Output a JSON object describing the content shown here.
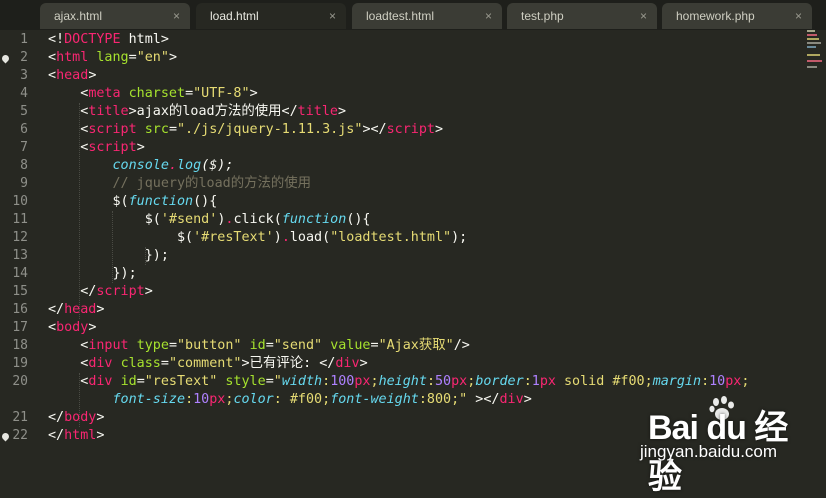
{
  "tabs": [
    {
      "label": "ajax.html",
      "close": "×"
    },
    {
      "label": "load.html",
      "close": "×"
    },
    {
      "label": "loadtest.html",
      "close": "×"
    },
    {
      "label": "test.php",
      "close": "×"
    },
    {
      "label": "homework.php",
      "close": "×"
    }
  ],
  "active_tab": "load.html",
  "line_numbers": [
    "1",
    "2",
    "3",
    "4",
    "5",
    "6",
    "7",
    "8",
    "9",
    "10",
    "11",
    "12",
    "13",
    "14",
    "15",
    "16",
    "17",
    "18",
    "19",
    "20",
    "",
    "21",
    "22"
  ],
  "colors": {
    "background": "#272822",
    "tag": "#f92672",
    "attr": "#a6e22e",
    "string": "#e6db74",
    "function": "#66d9ef",
    "comment": "#75715e",
    "number": "#ae81ff",
    "text": "#f8f8f2"
  },
  "code": {
    "l1": [
      {
        "t": "<!",
        "c": "text"
      },
      {
        "t": "DOCTYPE",
        "c": "tag"
      },
      {
        "t": " html>",
        "c": "text"
      }
    ],
    "l2": [
      {
        "t": "<",
        "c": "text"
      },
      {
        "t": "html",
        "c": "tag"
      },
      {
        "t": " ",
        "c": "text"
      },
      {
        "t": "lang",
        "c": "attr"
      },
      {
        "t": "=",
        "c": "text"
      },
      {
        "t": "\"en\"",
        "c": "string"
      },
      {
        "t": ">",
        "c": "text"
      }
    ],
    "l3": [
      {
        "t": "<",
        "c": "text"
      },
      {
        "t": "head",
        "c": "tag"
      },
      {
        "t": ">",
        "c": "text"
      }
    ],
    "l4": [
      {
        "t": "    <",
        "c": "text"
      },
      {
        "t": "meta",
        "c": "tag"
      },
      {
        "t": " ",
        "c": "text"
      },
      {
        "t": "charset",
        "c": "attr"
      },
      {
        "t": "=",
        "c": "text"
      },
      {
        "t": "\"UTF-8\"",
        "c": "string"
      },
      {
        "t": ">",
        "c": "text"
      }
    ],
    "l5": [
      {
        "t": "    <",
        "c": "text"
      },
      {
        "t": "title",
        "c": "tag"
      },
      {
        "t": ">ajax的load方法的使用</",
        "c": "text"
      },
      {
        "t": "title",
        "c": "tag"
      },
      {
        "t": ">",
        "c": "text"
      }
    ],
    "l6": [
      {
        "t": "    <",
        "c": "text"
      },
      {
        "t": "script",
        "c": "tag"
      },
      {
        "t": " ",
        "c": "text"
      },
      {
        "t": "src",
        "c": "attr"
      },
      {
        "t": "=",
        "c": "text"
      },
      {
        "t": "\"./js/jquery-1.11.3.js\"",
        "c": "string"
      },
      {
        "t": "></",
        "c": "text"
      },
      {
        "t": "script",
        "c": "tag"
      },
      {
        "t": ">",
        "c": "text"
      }
    ],
    "l7": [
      {
        "t": "    <",
        "c": "text"
      },
      {
        "t": "script",
        "c": "tag"
      },
      {
        "t": ">",
        "c": "text"
      }
    ],
    "l8": [
      {
        "t": "        ",
        "c": "text"
      },
      {
        "t": "console",
        "c": "function"
      },
      {
        "t": ".",
        "c": "tag"
      },
      {
        "t": "log",
        "c": "function"
      },
      {
        "t": "($);",
        "c": "text"
      }
    ],
    "l9": [
      {
        "t": "        // jquery的load的方法的使用",
        "c": "comment"
      }
    ],
    "l10": [
      {
        "t": "        $(",
        "c": "text"
      },
      {
        "t": "function",
        "c": "function"
      },
      {
        "t": "(){",
        "c": "text"
      }
    ],
    "l11": [
      {
        "t": "            $(",
        "c": "text"
      },
      {
        "t": "'#send'",
        "c": "string"
      },
      {
        "t": ")",
        "c": "text"
      },
      {
        "t": ".",
        "c": "tag"
      },
      {
        "t": "click(",
        "c": "text"
      },
      {
        "t": "function",
        "c": "function"
      },
      {
        "t": "(){",
        "c": "text"
      }
    ],
    "l12": [
      {
        "t": "                $(",
        "c": "text"
      },
      {
        "t": "'#resText'",
        "c": "string"
      },
      {
        "t": ")",
        "c": "text"
      },
      {
        "t": ".",
        "c": "tag"
      },
      {
        "t": "load(",
        "c": "text"
      },
      {
        "t": "\"loadtest.html\"",
        "c": "string"
      },
      {
        "t": ");",
        "c": "text"
      }
    ],
    "l13": [
      {
        "t": "            });",
        "c": "text"
      }
    ],
    "l14": [
      {
        "t": "        });",
        "c": "text"
      }
    ],
    "l15": [
      {
        "t": "    </",
        "c": "text"
      },
      {
        "t": "script",
        "c": "tag"
      },
      {
        "t": ">",
        "c": "text"
      }
    ],
    "l16": [
      {
        "t": "</",
        "c": "text"
      },
      {
        "t": "head",
        "c": "tag"
      },
      {
        "t": ">",
        "c": "text"
      }
    ],
    "l17": [
      {
        "t": "<",
        "c": "text"
      },
      {
        "t": "body",
        "c": "tag"
      },
      {
        "t": ">",
        "c": "text"
      }
    ],
    "l18": [
      {
        "t": "    <",
        "c": "text"
      },
      {
        "t": "input",
        "c": "tag"
      },
      {
        "t": " ",
        "c": "text"
      },
      {
        "t": "type",
        "c": "attr"
      },
      {
        "t": "=",
        "c": "text"
      },
      {
        "t": "\"button\"",
        "c": "string"
      },
      {
        "t": " ",
        "c": "text"
      },
      {
        "t": "id",
        "c": "attr"
      },
      {
        "t": "=",
        "c": "text"
      },
      {
        "t": "\"send\"",
        "c": "string"
      },
      {
        "t": " ",
        "c": "text"
      },
      {
        "t": "value",
        "c": "attr"
      },
      {
        "t": "=",
        "c": "text"
      },
      {
        "t": "\"Ajax获取\"",
        "c": "string"
      },
      {
        "t": "/>",
        "c": "text"
      }
    ],
    "l19": [
      {
        "t": "    <",
        "c": "text"
      },
      {
        "t": "div",
        "c": "tag"
      },
      {
        "t": " ",
        "c": "text"
      },
      {
        "t": "class",
        "c": "attr"
      },
      {
        "t": "=",
        "c": "text"
      },
      {
        "t": "\"comment\"",
        "c": "string"
      },
      {
        "t": ">已有评论: </",
        "c": "text"
      },
      {
        "t": "div",
        "c": "tag"
      },
      {
        "t": ">",
        "c": "text"
      }
    ],
    "l20": [
      {
        "t": "    <",
        "c": "text"
      },
      {
        "t": "div",
        "c": "tag"
      },
      {
        "t": " ",
        "c": "text"
      },
      {
        "t": "id",
        "c": "attr"
      },
      {
        "t": "=",
        "c": "text"
      },
      {
        "t": "\"resText\"",
        "c": "string"
      },
      {
        "t": " ",
        "c": "text"
      },
      {
        "t": "style",
        "c": "attr"
      },
      {
        "t": "=",
        "c": "text"
      },
      {
        "t": "\"",
        "c": "string"
      },
      {
        "t": "width",
        "c": "function"
      },
      {
        "t": ":",
        "c": "string"
      },
      {
        "t": "100",
        "c": "number"
      },
      {
        "t": "px",
        "c": "tag"
      },
      {
        "t": ";",
        "c": "string"
      },
      {
        "t": "height",
        "c": "function"
      },
      {
        "t": ":",
        "c": "string"
      },
      {
        "t": "50",
        "c": "number"
      },
      {
        "t": "px",
        "c": "tag"
      },
      {
        "t": ";",
        "c": "string"
      },
      {
        "t": "border",
        "c": "function"
      },
      {
        "t": ":",
        "c": "string"
      },
      {
        "t": "1",
        "c": "number"
      },
      {
        "t": "px",
        "c": "tag"
      },
      {
        "t": " solid #f00;",
        "c": "string"
      },
      {
        "t": "margin",
        "c": "function"
      },
      {
        "t": ":",
        "c": "string"
      },
      {
        "t": "10",
        "c": "number"
      },
      {
        "t": "px",
        "c": "tag"
      },
      {
        "t": ";",
        "c": "string"
      }
    ],
    "l20b": [
      {
        "t": "        ",
        "c": "text"
      },
      {
        "t": "font-size",
        "c": "function"
      },
      {
        "t": ":",
        "c": "string"
      },
      {
        "t": "10",
        "c": "number"
      },
      {
        "t": "px",
        "c": "tag"
      },
      {
        "t": ";",
        "c": "string"
      },
      {
        "t": "color",
        "c": "function"
      },
      {
        "t": ": #f00;",
        "c": "string"
      },
      {
        "t": "font-weight",
        "c": "function"
      },
      {
        "t": ":800;\"",
        "c": "string"
      },
      {
        "t": " ></",
        "c": "text"
      },
      {
        "t": "div",
        "c": "tag"
      },
      {
        "t": ">",
        "c": "text"
      }
    ],
    "l21": [
      {
        "t": "</",
        "c": "text"
      },
      {
        "t": "body",
        "c": "tag"
      },
      {
        "t": ">",
        "c": "text"
      }
    ],
    "l22": [
      {
        "t": "</",
        "c": "text"
      },
      {
        "t": "html",
        "c": "tag"
      },
      {
        "t": ">",
        "c": "text"
      }
    ]
  },
  "watermark": {
    "brand": "Bai du 经验",
    "url": "jingyan.baidu.com"
  }
}
